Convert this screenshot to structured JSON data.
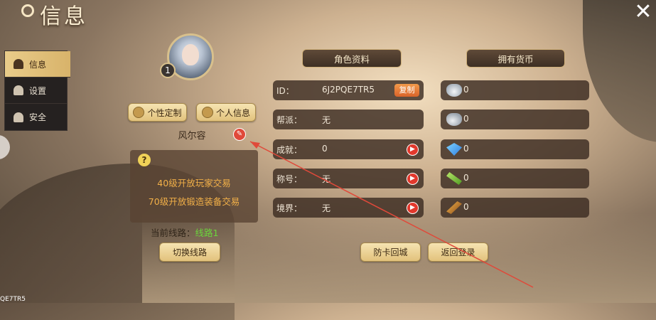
{
  "title": "信息",
  "sidebar": {
    "items": [
      {
        "label": "信息",
        "active": true,
        "icon": "person-icon"
      },
      {
        "label": "设置",
        "active": false,
        "icon": "hammer-icon"
      },
      {
        "label": "安全",
        "active": false,
        "icon": "users-icon"
      }
    ]
  },
  "profile": {
    "level": "1",
    "customize_label": "个性定制",
    "personal_info_label": "个人信息",
    "name": "风尔容",
    "info_lines": [
      "40级开放玩家交易",
      "70级开放锻造装备交易"
    ],
    "line_prefix": "当前线路：",
    "line_value": "线路1",
    "switch_line_label": "切换线路"
  },
  "sections": {
    "character_header": "角色资料",
    "currency_header": "拥有货币"
  },
  "character_rows": [
    {
      "key": "ID：",
      "value": "6J2PQE7TR5",
      "action": "复制"
    },
    {
      "key": "帮派：",
      "value": "无"
    },
    {
      "key": "成就：",
      "value": "0"
    },
    {
      "key": "称号：",
      "value": "无"
    },
    {
      "key": "境界：",
      "value": "无"
    }
  ],
  "currencies": [
    {
      "icon": "silver-ingot-icon",
      "value": "0"
    },
    {
      "icon": "locked-silver-icon",
      "value": "0"
    },
    {
      "icon": "blue-gem-icon",
      "value": "0"
    },
    {
      "icon": "jade-icon",
      "value": "0"
    },
    {
      "icon": "gold-scroll-icon",
      "value": "0"
    }
  ],
  "bottom_buttons": {
    "unstuck": "防卡回城",
    "return_login": "返回登录"
  },
  "footer_stamp": "QE7TR5",
  "colors": {
    "accent_gold": "#e2c27c",
    "warning_orange": "#f2b048",
    "line_green": "#6cd63c",
    "annotation_red": "#e0493a"
  }
}
